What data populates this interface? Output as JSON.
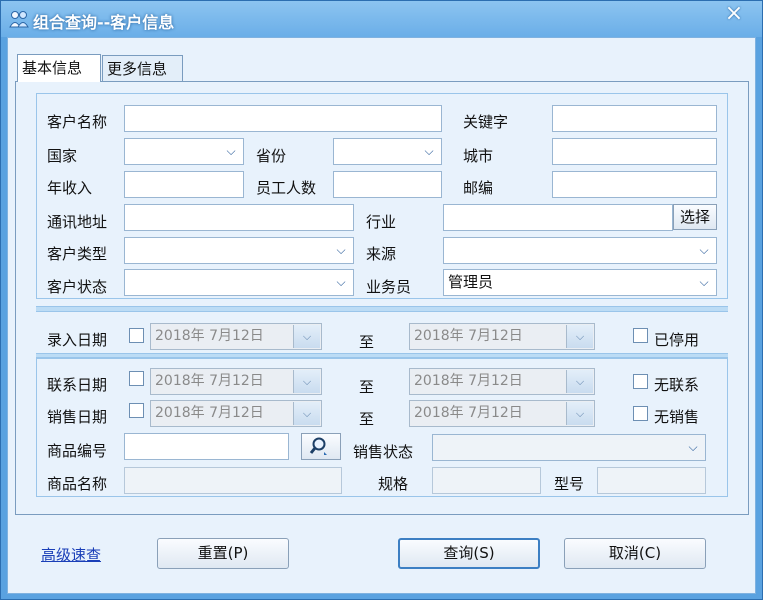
{
  "window": {
    "title": "组合查询--客户信息",
    "close_glyph": "×"
  },
  "tabs": [
    {
      "label": "基本信息",
      "active": true
    },
    {
      "label": "更多信息",
      "active": false
    }
  ],
  "labels": {
    "customer_name": "客户名称",
    "keyword": "关键字",
    "country": "国家",
    "province": "省份",
    "city": "城市",
    "annual_income": "年收入",
    "employee_count": "员工人数",
    "postcode": "邮编",
    "address": "通讯地址",
    "industry": "行业",
    "customer_type": "客户类型",
    "source": "来源",
    "customer_status": "客户状态",
    "salesperson": "业务员",
    "entry_date": "录入日期",
    "to": "至",
    "disabled": "已停用",
    "contact_date": "联系日期",
    "no_contact": "无联系",
    "sales_date": "销售日期",
    "no_sales": "无销售",
    "product_code": "商品编号",
    "sales_status": "销售状态",
    "product_name": "商品名称",
    "spec": "规格",
    "model": "型号"
  },
  "values": {
    "customer_name": "",
    "keyword": "",
    "country": "",
    "province": "",
    "city": "",
    "annual_income": "",
    "employee_count": "",
    "postcode": "",
    "address": "",
    "industry": "",
    "customer_type": "",
    "source": "",
    "customer_status": "",
    "salesperson": "管理员",
    "product_code": "",
    "sales_status": "",
    "product_name": "",
    "spec": "",
    "model": ""
  },
  "dates": {
    "entry_from": "2018年  7月12日",
    "entry_to": "2018年  7月12日",
    "contact_from": "2018年  7月12日",
    "contact_to": "2018年  7月12日",
    "sales_from": "2018年  7月12日",
    "sales_to": "2018年  7月12日"
  },
  "buttons": {
    "select": "选择",
    "reset": "重置(P)",
    "query": "查询(S)",
    "cancel": "取消(C)"
  },
  "links": {
    "advanced": "高级速查"
  },
  "icons": {
    "app": "app-icon",
    "search": "magnifier-icon",
    "dropdown": "chevron-down-icon"
  },
  "colors": {
    "title_bar": "#6aaee8",
    "client_bg": "#e8f2fc",
    "link": "#1a3fb8",
    "default_button_border": "#3c7fc3"
  }
}
